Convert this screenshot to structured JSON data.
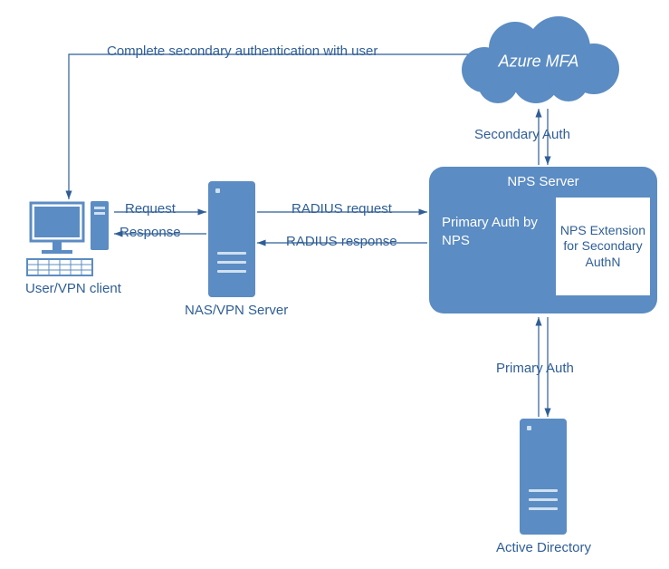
{
  "nodes": {
    "cloud": {
      "label": "Azure MFA"
    },
    "nps_server": {
      "title": "NPS Server",
      "primary": "Primary Auth by NPS",
      "extension": "NPS Extension for Secondary AuthN"
    },
    "nas": {
      "label": "NAS/VPN Server"
    },
    "client": {
      "label": "User/VPN client"
    },
    "ad": {
      "label": "Active Directory"
    }
  },
  "edges": {
    "complete_secondary": "Complete secondary authentication with user",
    "secondary_auth": "Secondary Auth",
    "request": "Request",
    "response": "Response",
    "radius_request": "RADIUS request",
    "radius_response": "RADIUS response",
    "primary_auth": "Primary Auth"
  },
  "colors": {
    "shape_fill": "#5b8cc3",
    "text": "#2f5e96"
  }
}
